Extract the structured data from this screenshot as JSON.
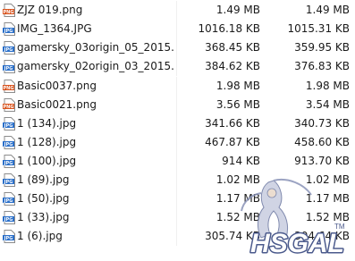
{
  "files": [
    {
      "name": "ZJZ 019.png",
      "type": "png",
      "size_a": "1.49 MB",
      "size_b": "1.49 MB"
    },
    {
      "name": "IMG_1364.JPG",
      "type": "jpg",
      "size_a": "1016.18 KB",
      "size_b": "1015.31 KB"
    },
    {
      "name": "gamersky_03origin_05_2015...",
      "type": "jpg",
      "size_a": "368.45 KB",
      "size_b": "359.95 KB"
    },
    {
      "name": "gamersky_02origin_03_2015...",
      "type": "jpg",
      "size_a": "384.62 KB",
      "size_b": "376.83 KB"
    },
    {
      "name": "Basic0037.png",
      "type": "png",
      "size_a": "1.98 MB",
      "size_b": "1.98 MB"
    },
    {
      "name": "Basic0021.png",
      "type": "png",
      "size_a": "3.56 MB",
      "size_b": "3.54 MB"
    },
    {
      "name": "1 (134).jpg",
      "type": "jpg",
      "size_a": "341.66 KB",
      "size_b": "340.73 KB"
    },
    {
      "name": "1 (128).jpg",
      "type": "jpg",
      "size_a": "467.87 KB",
      "size_b": "458.60 KB"
    },
    {
      "name": "1 (100).jpg",
      "type": "jpg",
      "size_a": "914 KB",
      "size_b": "913.70 KB"
    },
    {
      "name": "1 (89).jpg",
      "type": "jpg",
      "size_a": "1.02 MB",
      "size_b": "1.02 MB"
    },
    {
      "name": "1 (50).jpg",
      "type": "jpg",
      "size_a": "1.17 MB",
      "size_b": "1.17 MB"
    },
    {
      "name": "1 (33).jpg",
      "type": "jpg",
      "size_a": "1.52 MB",
      "size_b": "1.52 MB"
    },
    {
      "name": "1 (6).jpg",
      "type": "jpg",
      "size_a": "305.74 KB",
      "size_b": "304.64 KB"
    }
  ],
  "icons": {
    "png": {
      "label": "PNG",
      "color": "#d9541e"
    },
    "jpg": {
      "label": "JPG",
      "color": "#2a6fc9"
    }
  },
  "watermark": {
    "text": "HSGAL",
    "color": "#4b5a8c"
  }
}
